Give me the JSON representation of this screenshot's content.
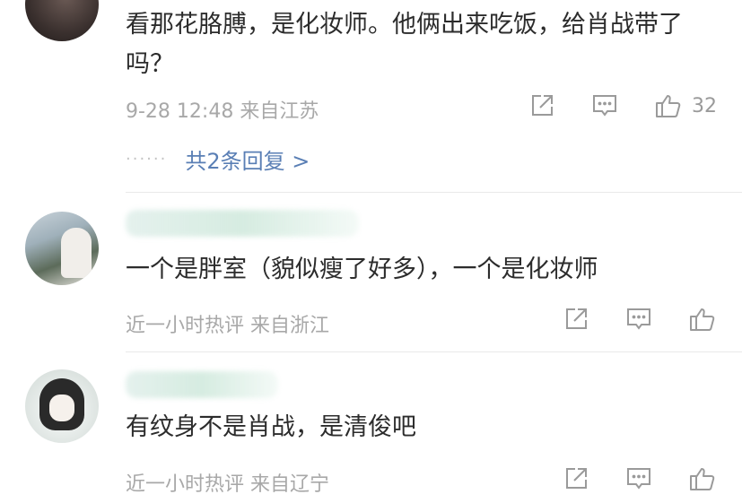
{
  "comments": [
    {
      "text": "看那花胳膊，是化妆师。他俩出来吃饭，给肖战带了吗？",
      "meta": "9-28 12:48  来自江苏",
      "like_count": "32",
      "replies_dots": "······",
      "replies_label": "共2条回复 >"
    },
    {
      "text": "一个是胖室（貌似瘦了好多），一个是化妆师",
      "meta": "近一小时热评  来自浙江",
      "like_count": ""
    },
    {
      "text": "有纹身不是肖战，是清俊吧",
      "meta": "近一小时热评  来自辽宁",
      "like_count": ""
    }
  ],
  "icons": {
    "share": "share-icon",
    "comment": "comment-icon",
    "like": "thumbs-up-icon"
  },
  "colors": {
    "link": "#5a7fb5",
    "meta": "#a8a8a8",
    "icon": "#9a9a9a"
  }
}
